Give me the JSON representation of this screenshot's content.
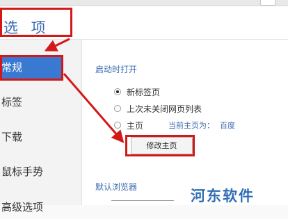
{
  "header": {
    "title": "选 项"
  },
  "sidebar": {
    "items": [
      {
        "label": "常规",
        "active": true
      },
      {
        "label": "标签"
      },
      {
        "label": "下载"
      },
      {
        "label": "鼠标手势"
      },
      {
        "label": "高级选项"
      }
    ]
  },
  "startup": {
    "title": "启动时打开",
    "options": [
      {
        "label": "新标签页",
        "checked": true
      },
      {
        "label": "上次未关闭网页列表",
        "checked": false
      },
      {
        "label": "主页",
        "checked": false
      }
    ],
    "current_home_label": "当前主页为：",
    "current_home_value": "百度",
    "edit_home_button": "修改主页"
  },
  "default_browser": {
    "title": "默认浏览器"
  },
  "watermark": {
    "text": "河东软件"
  },
  "colors": {
    "highlight": "#d41818",
    "accent": "#3a6bb0",
    "active_item": "#3a79d1"
  }
}
